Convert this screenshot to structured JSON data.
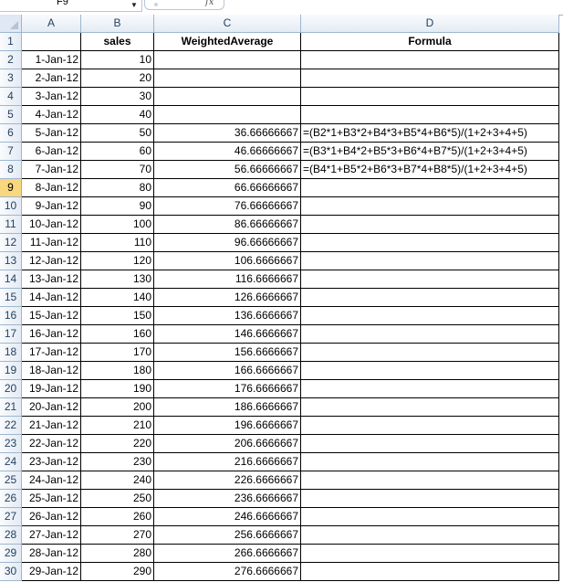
{
  "name_box": "F9",
  "formula_icon": "fx",
  "columns": [
    "A",
    "B",
    "C",
    "D"
  ],
  "selected_row": "9",
  "header_row": {
    "row": "1",
    "cells": [
      "",
      "sales",
      "WeightedAverage",
      "Formula"
    ]
  },
  "rows": [
    {
      "row": "2",
      "cells": [
        "1-Jan-12",
        "10",
        "",
        ""
      ]
    },
    {
      "row": "3",
      "cells": [
        "2-Jan-12",
        "20",
        "",
        ""
      ]
    },
    {
      "row": "4",
      "cells": [
        "3-Jan-12",
        "30",
        "",
        ""
      ]
    },
    {
      "row": "5",
      "cells": [
        "4-Jan-12",
        "40",
        "",
        ""
      ]
    },
    {
      "row": "6",
      "cells": [
        "5-Jan-12",
        "50",
        "36.66666667",
        "=(B2*1+B3*2+B4*3+B5*4+B6*5)/(1+2+3+4+5)"
      ]
    },
    {
      "row": "7",
      "cells": [
        "6-Jan-12",
        "60",
        "46.66666667",
        "=(B3*1+B4*2+B5*3+B6*4+B7*5)/(1+2+3+4+5)"
      ]
    },
    {
      "row": "8",
      "cells": [
        "7-Jan-12",
        "70",
        "56.66666667",
        "=(B4*1+B5*2+B6*3+B7*4+B8*5)/(1+2+3+4+5)"
      ]
    },
    {
      "row": "9",
      "cells": [
        "8-Jan-12",
        "80",
        "66.66666667",
        ""
      ]
    },
    {
      "row": "10",
      "cells": [
        "9-Jan-12",
        "90",
        "76.66666667",
        ""
      ]
    },
    {
      "row": "11",
      "cells": [
        "10-Jan-12",
        "100",
        "86.66666667",
        ""
      ]
    },
    {
      "row": "12",
      "cells": [
        "11-Jan-12",
        "110",
        "96.66666667",
        ""
      ]
    },
    {
      "row": "13",
      "cells": [
        "12-Jan-12",
        "120",
        "106.6666667",
        ""
      ]
    },
    {
      "row": "14",
      "cells": [
        "13-Jan-12",
        "130",
        "116.6666667",
        ""
      ]
    },
    {
      "row": "15",
      "cells": [
        "14-Jan-12",
        "140",
        "126.6666667",
        ""
      ]
    },
    {
      "row": "16",
      "cells": [
        "15-Jan-12",
        "150",
        "136.6666667",
        ""
      ]
    },
    {
      "row": "17",
      "cells": [
        "16-Jan-12",
        "160",
        "146.6666667",
        ""
      ]
    },
    {
      "row": "18",
      "cells": [
        "17-Jan-12",
        "170",
        "156.6666667",
        ""
      ]
    },
    {
      "row": "19",
      "cells": [
        "18-Jan-12",
        "180",
        "166.6666667",
        ""
      ]
    },
    {
      "row": "20",
      "cells": [
        "19-Jan-12",
        "190",
        "176.6666667",
        ""
      ]
    },
    {
      "row": "21",
      "cells": [
        "20-Jan-12",
        "200",
        "186.6666667",
        ""
      ]
    },
    {
      "row": "22",
      "cells": [
        "21-Jan-12",
        "210",
        "196.6666667",
        ""
      ]
    },
    {
      "row": "23",
      "cells": [
        "22-Jan-12",
        "220",
        "206.6666667",
        ""
      ]
    },
    {
      "row": "24",
      "cells": [
        "23-Jan-12",
        "230",
        "216.6666667",
        ""
      ]
    },
    {
      "row": "25",
      "cells": [
        "24-Jan-12",
        "240",
        "226.6666667",
        ""
      ]
    },
    {
      "row": "26",
      "cells": [
        "25-Jan-12",
        "250",
        "236.6666667",
        ""
      ]
    },
    {
      "row": "27",
      "cells": [
        "26-Jan-12",
        "260",
        "246.6666667",
        ""
      ]
    },
    {
      "row": "28",
      "cells": [
        "27-Jan-12",
        "270",
        "256.6666667",
        ""
      ]
    },
    {
      "row": "29",
      "cells": [
        "28-Jan-12",
        "280",
        "266.6666667",
        ""
      ]
    },
    {
      "row": "30",
      "cells": [
        "29-Jan-12",
        "290",
        "276.6666667",
        ""
      ]
    }
  ]
}
